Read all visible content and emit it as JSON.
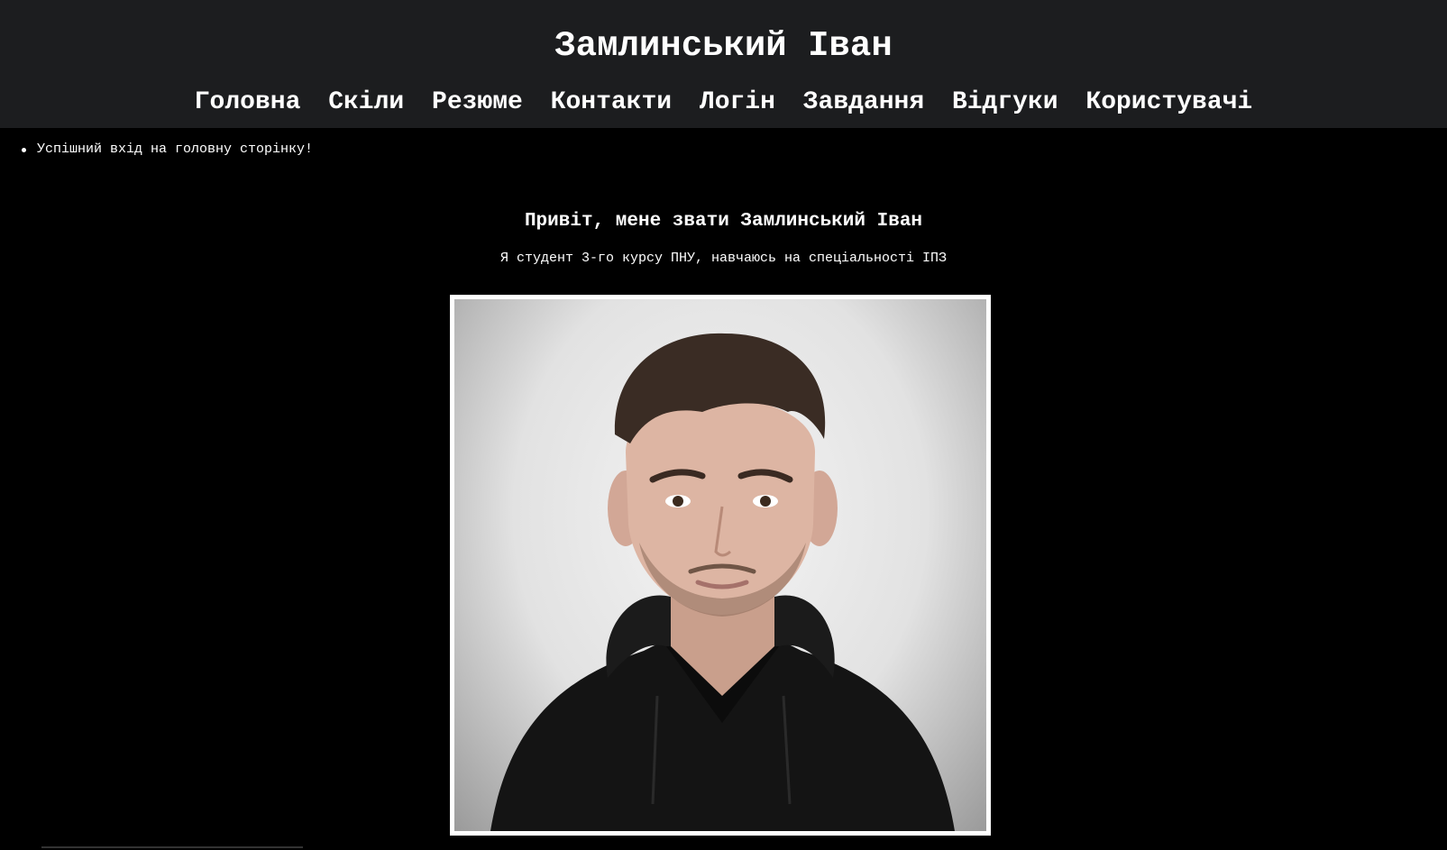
{
  "header": {
    "title": "Замлинський Іван",
    "nav": [
      {
        "label": "Головна"
      },
      {
        "label": "Скіли"
      },
      {
        "label": "Резюме"
      },
      {
        "label": "Контакти"
      },
      {
        "label": "Логін"
      },
      {
        "label": "Завдання"
      },
      {
        "label": "Відгуки"
      },
      {
        "label": "Користувачі"
      }
    ]
  },
  "flash_messages": [
    "Успішний вхід на головну сторінку!"
  ],
  "main": {
    "greeting": "Привіт, мене звати Замлинський Іван",
    "intro": "Я студент 3-го курсу ПНУ, навчаюсь на спеціальності ІПЗ",
    "photo": {
      "subject": "portrait-photo"
    }
  },
  "colors": {
    "page_background": "#000000",
    "header_background": "#1c1d1f",
    "text": "#ffffff",
    "photo_border": "#ffffff"
  }
}
